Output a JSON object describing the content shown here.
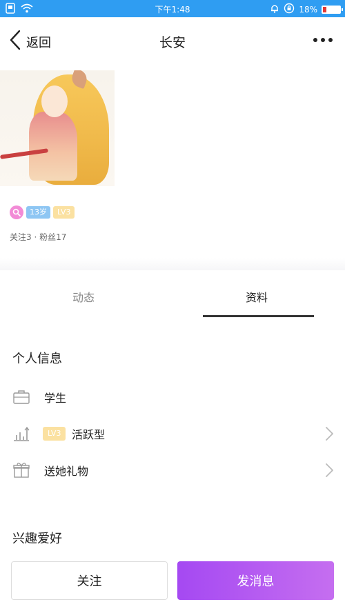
{
  "status_bar": {
    "time": "下午1:48",
    "battery_text": "18%",
    "icons": [
      "sim-icon",
      "wifi-icon",
      "alarm-icon",
      "rotation-lock-icon",
      "battery-icon"
    ]
  },
  "nav": {
    "back_label": "返回",
    "title": "长安",
    "more_icon": "more-icon"
  },
  "profile": {
    "age_badge": "13岁",
    "level_badge": "LV3",
    "stats": "关注3 · 粉丝17"
  },
  "tabs": {
    "dynamic": "动态",
    "profile": "资料",
    "active": "资料"
  },
  "personal_info": {
    "title": "个人信息",
    "occupation": "学生",
    "activity_level": "LV3",
    "activity_type": "活跃型",
    "gift": "送她礼物"
  },
  "hobbies": {
    "title": "兴趣爱好"
  },
  "actions": {
    "follow": "关注",
    "message": "发消息"
  },
  "colors": {
    "status_bar": "#2f9df2",
    "message_button_start": "#a549f2",
    "message_button_end": "#c56ef0",
    "level_badge": "#fbe1a1",
    "age_badge": "#8ec6f3",
    "search_badge": "#f28bd6"
  }
}
